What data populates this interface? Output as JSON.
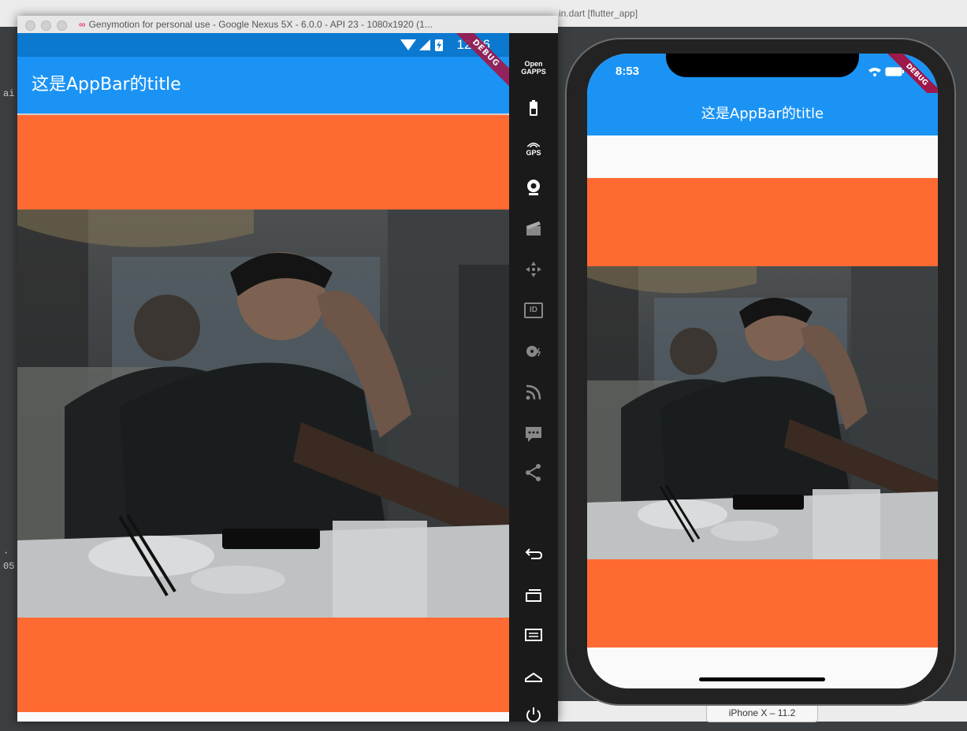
{
  "ide": {
    "window_title": "in.dart [flutter_app]",
    "device_tag": "iPhone X – 11.2",
    "left_snips": [
      "ai",
      "·",
      "05"
    ]
  },
  "genymotion": {
    "window_title": "Genymotion for personal use - Google Nexus 5X - 6.0.0 - API 23 - 1080x1920 (1...",
    "toolbar": {
      "open_gapps": "Open\nGAPPS",
      "gps_label": "GPS",
      "id_label": "ID"
    }
  },
  "android_app": {
    "status_time": "12:26",
    "appbar_title": "这是AppBar的title",
    "debug_banner": "DEBUG",
    "colors": {
      "status_bar": "#0b79d0",
      "appbar": "#1b93f4",
      "container": "#ff6a33",
      "background": "#fafafa"
    }
  },
  "ios_app": {
    "status_time": "8:53",
    "appbar_title": "这是AppBar的title",
    "debug_banner": "DEBUG"
  },
  "icons": {
    "toolbar": [
      "battery-icon",
      "gps-icon",
      "webcam-icon",
      "capture-icon",
      "dpad-icon",
      "id-icon",
      "disk-icon",
      "cast-icon",
      "sms-icon",
      "share-icon",
      "back-icon",
      "recent-apps-icon",
      "menu-icon",
      "home-icon",
      "power-icon"
    ]
  }
}
